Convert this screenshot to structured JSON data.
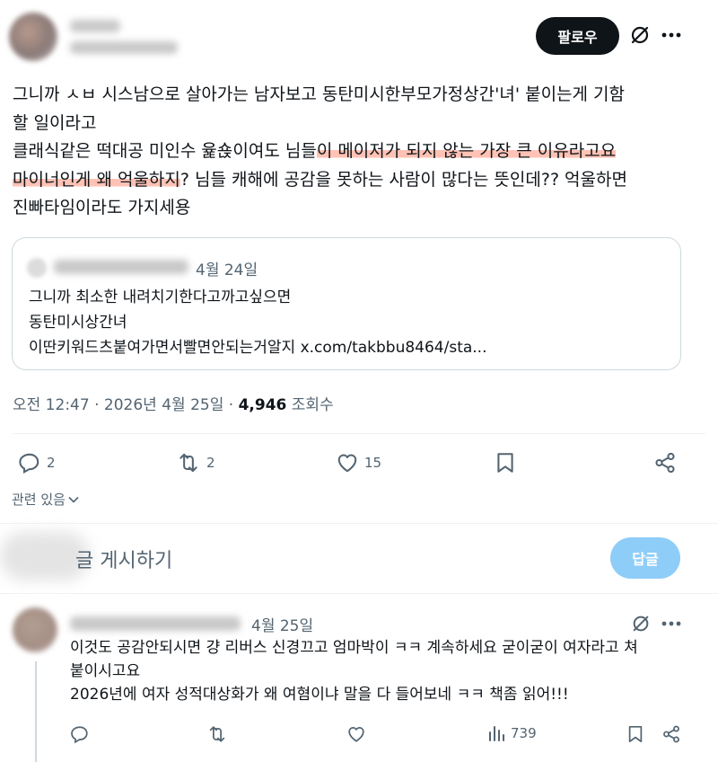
{
  "post": {
    "follow_label": "팔로우",
    "text_lines": [
      "그니까 ㅅㅂ 시스남으로 살아가는 남자보고 동탄미시한부모가정상간'녀' 붙이는게 기함",
      "할 일이라고"
    ],
    "line3_pre": "클래식같은 떡대공 미인수 윭숁이여도 님들",
    "line3_hl": "이 메이저가 되지 않는 가장 큰 이유라고요",
    "line4_hl": "마이너인게 왜 억울하지",
    "line4_post": "? 님들 캐해에 공감을 못하는 사람이 많다는 뜻인데?? 억울하면",
    "line5": "진빠타임이라도 가지세용",
    "quote": {
      "date": "4월 24일",
      "lines": [
        "그니까 최소한 내려치기한다고까고싶으면",
        "동탄미시상간녀",
        "이딴키워드츠붙여가면서빨면안되는거알지 x.com/takbbu8464/sta..."
      ]
    },
    "meta": {
      "time": "오전 12:47",
      "sep": " · ",
      "date": "2026년 4월 25일",
      "views": "4,946",
      "views_label": "조회수"
    },
    "actions": {
      "replies": "2",
      "reposts": "2",
      "likes": "15"
    },
    "related_label": "관련 있음"
  },
  "compose": {
    "placeholder": "글 게시하기",
    "reply_label": "답글"
  },
  "reply": {
    "date": "4월 25일",
    "lines": [
      "이것도 공감안되시면 걍 리버스 신경끄고 엄마박이 ㅋㅋ 계속하세요 굳이굳이 여자라고 쳐",
      "붙이시고요",
      "2026년에 여자 성적대상화가 왜 여혐이냐 말을 다 들어보네 ㅋㅋ 책좀 읽어!!!"
    ],
    "views": "739"
  },
  "colors": {
    "accent_button": "#0f1419",
    "reply_button_disabled": "#8ecdf8",
    "highlight": "#ff785a",
    "muted_text": "#536471"
  }
}
